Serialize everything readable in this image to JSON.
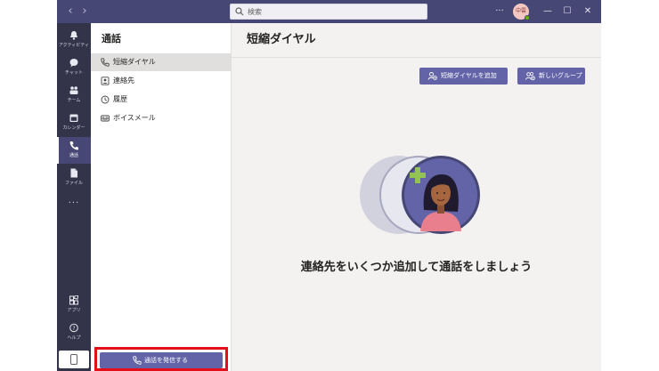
{
  "titlebar": {
    "back_icon": "chevron-left-icon",
    "forward_icon": "chevron-right-icon",
    "search_placeholder": "検索",
    "more": "···",
    "avatar_initials": "中雲",
    "minimize": "—",
    "maximize": "☐",
    "close": "✕"
  },
  "rail": {
    "items": [
      {
        "label": "アクティビティ",
        "icon": "bell-icon"
      },
      {
        "label": "チャット",
        "icon": "chat-icon"
      },
      {
        "label": "チーム",
        "icon": "teams-icon"
      },
      {
        "label": "カレンダー",
        "icon": "calendar-icon"
      },
      {
        "label": "通話",
        "icon": "phone-icon",
        "active": true
      },
      {
        "label": "ファイル",
        "icon": "file-icon"
      }
    ],
    "more": "···",
    "apps_label": "アプリ",
    "help_label": "ヘルプ"
  },
  "pane": {
    "title": "通話",
    "items": [
      {
        "label": "短縮ダイヤル",
        "icon": "phone-icon",
        "selected": true
      },
      {
        "label": "連絡先",
        "icon": "contact-icon"
      },
      {
        "label": "履歴",
        "icon": "history-icon"
      },
      {
        "label": "ボイスメール",
        "icon": "voicemail-icon"
      }
    ],
    "make_call_label": "通話を発信する"
  },
  "main": {
    "title": "短縮ダイヤル",
    "add_speed_dial_label": "短縮ダイヤルを追加",
    "new_group_label": "新しいグループ",
    "empty_message": "連絡先をいくつか追加して通話をしましょう"
  },
  "colors": {
    "titlebar": "#464775",
    "rail": "#33344a",
    "accent": "#6264a7",
    "highlight": "#e3101b",
    "status_available": "#6bb700"
  }
}
